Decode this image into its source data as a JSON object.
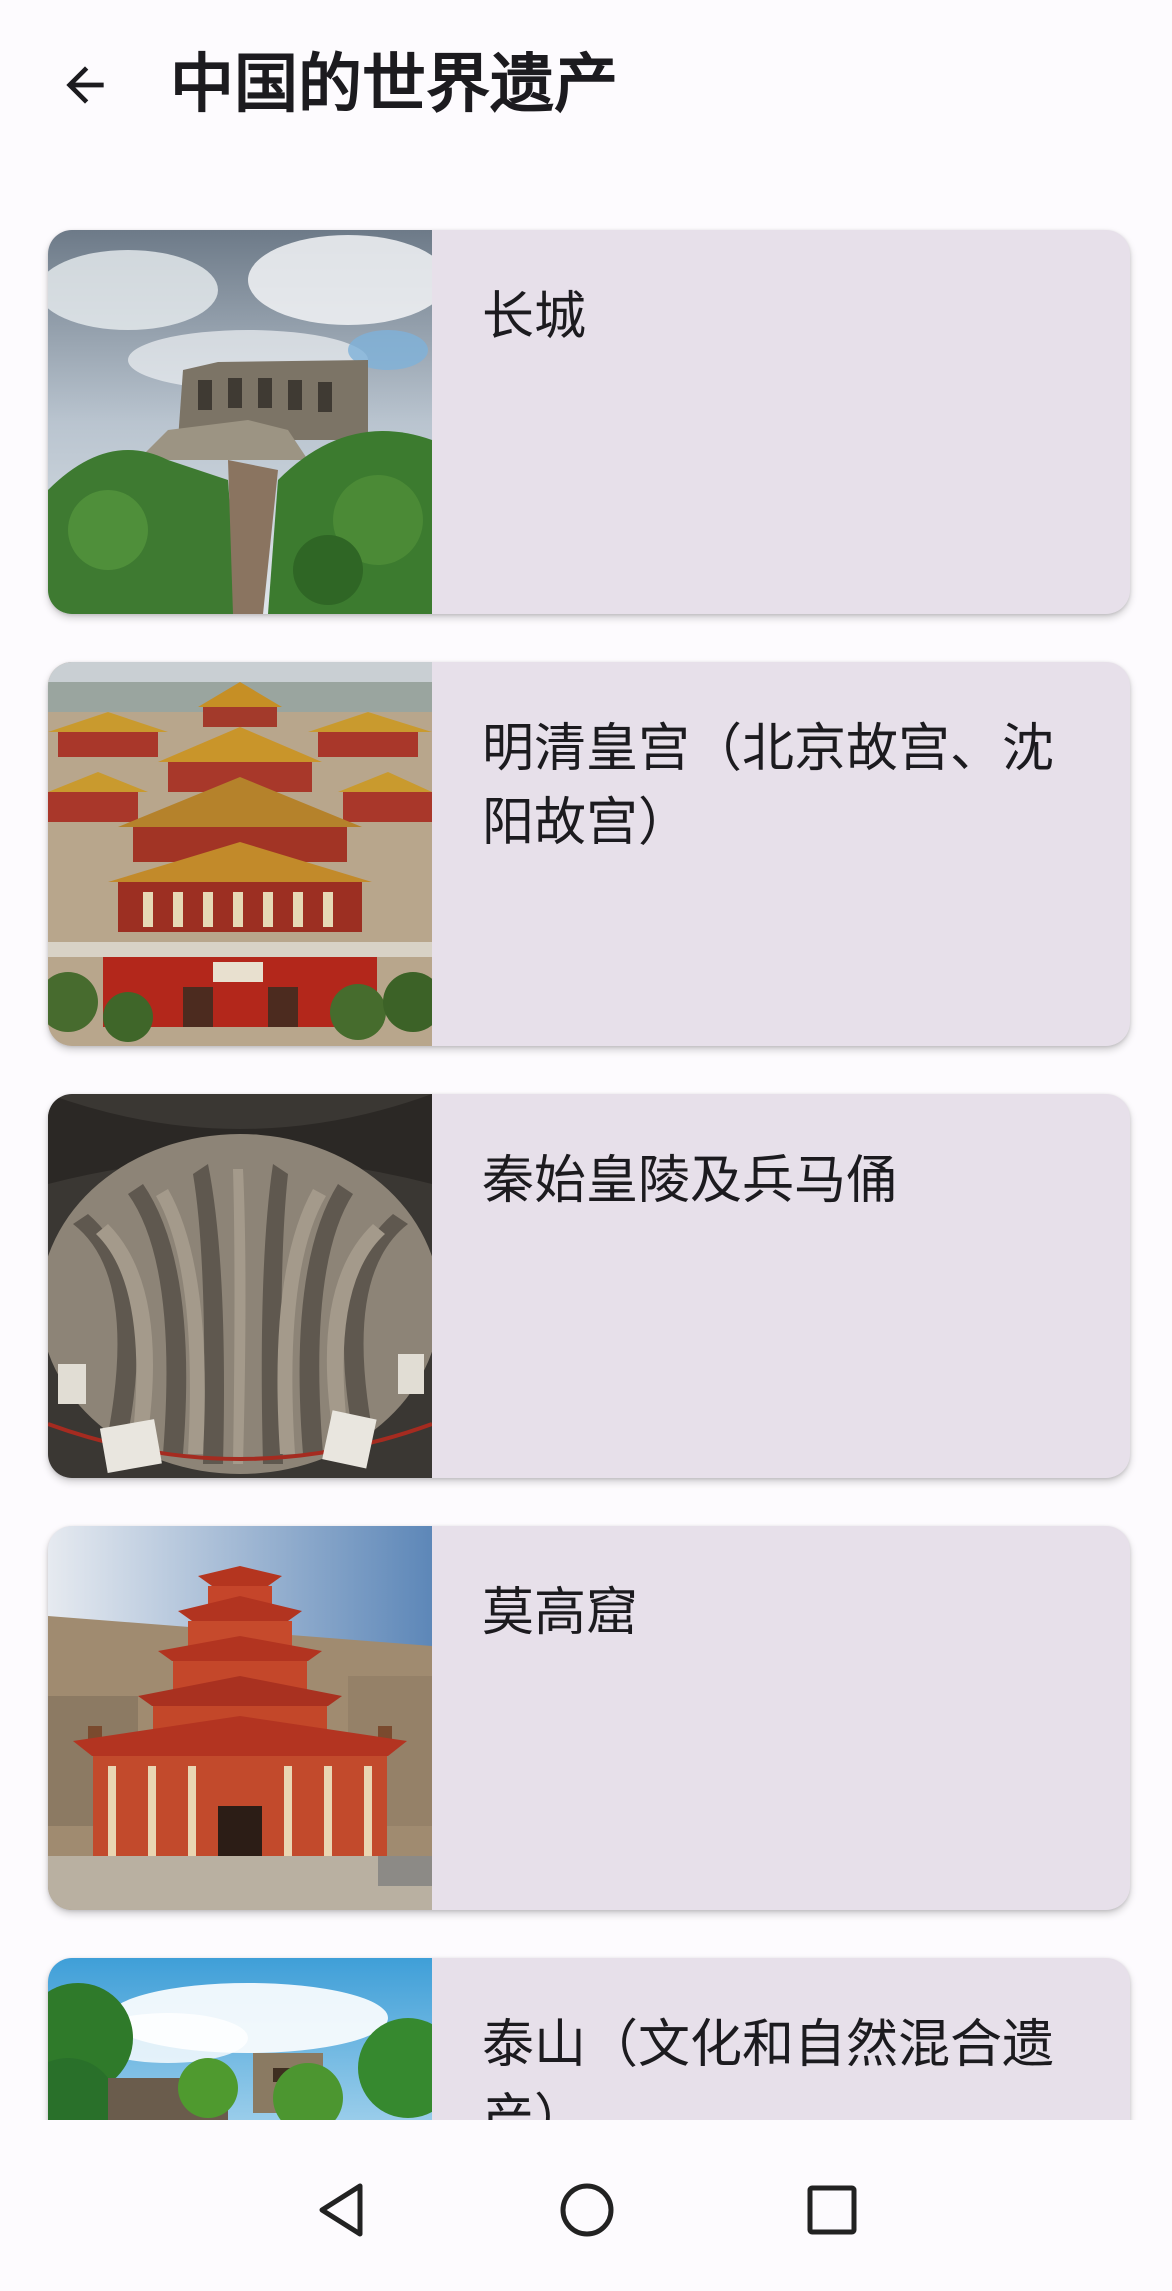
{
  "header": {
    "title": "中国的世界遗产",
    "back_icon": "arrow-back-icon"
  },
  "sites": [
    {
      "name": "长城",
      "image": "great-wall-photo"
    },
    {
      "name": "明清皇宫（北京故宫、沈阳故宫）",
      "image": "imperial-palace-photo"
    },
    {
      "name": "秦始皇陵及兵马俑",
      "image": "terracotta-army-photo"
    },
    {
      "name": "莫高窟",
      "image": "mogao-caves-photo"
    },
    {
      "name": "泰山（文化和自然混合遗产）",
      "image": "mount-tai-photo"
    }
  ],
  "nav": {
    "back_icon": "triangle-back-icon",
    "home_icon": "circle-home-icon",
    "recents_icon": "square-recents-icon"
  },
  "colors": {
    "background": "#fdfbfe",
    "card": "#e7e0ea",
    "text": "#1c1b1f"
  }
}
